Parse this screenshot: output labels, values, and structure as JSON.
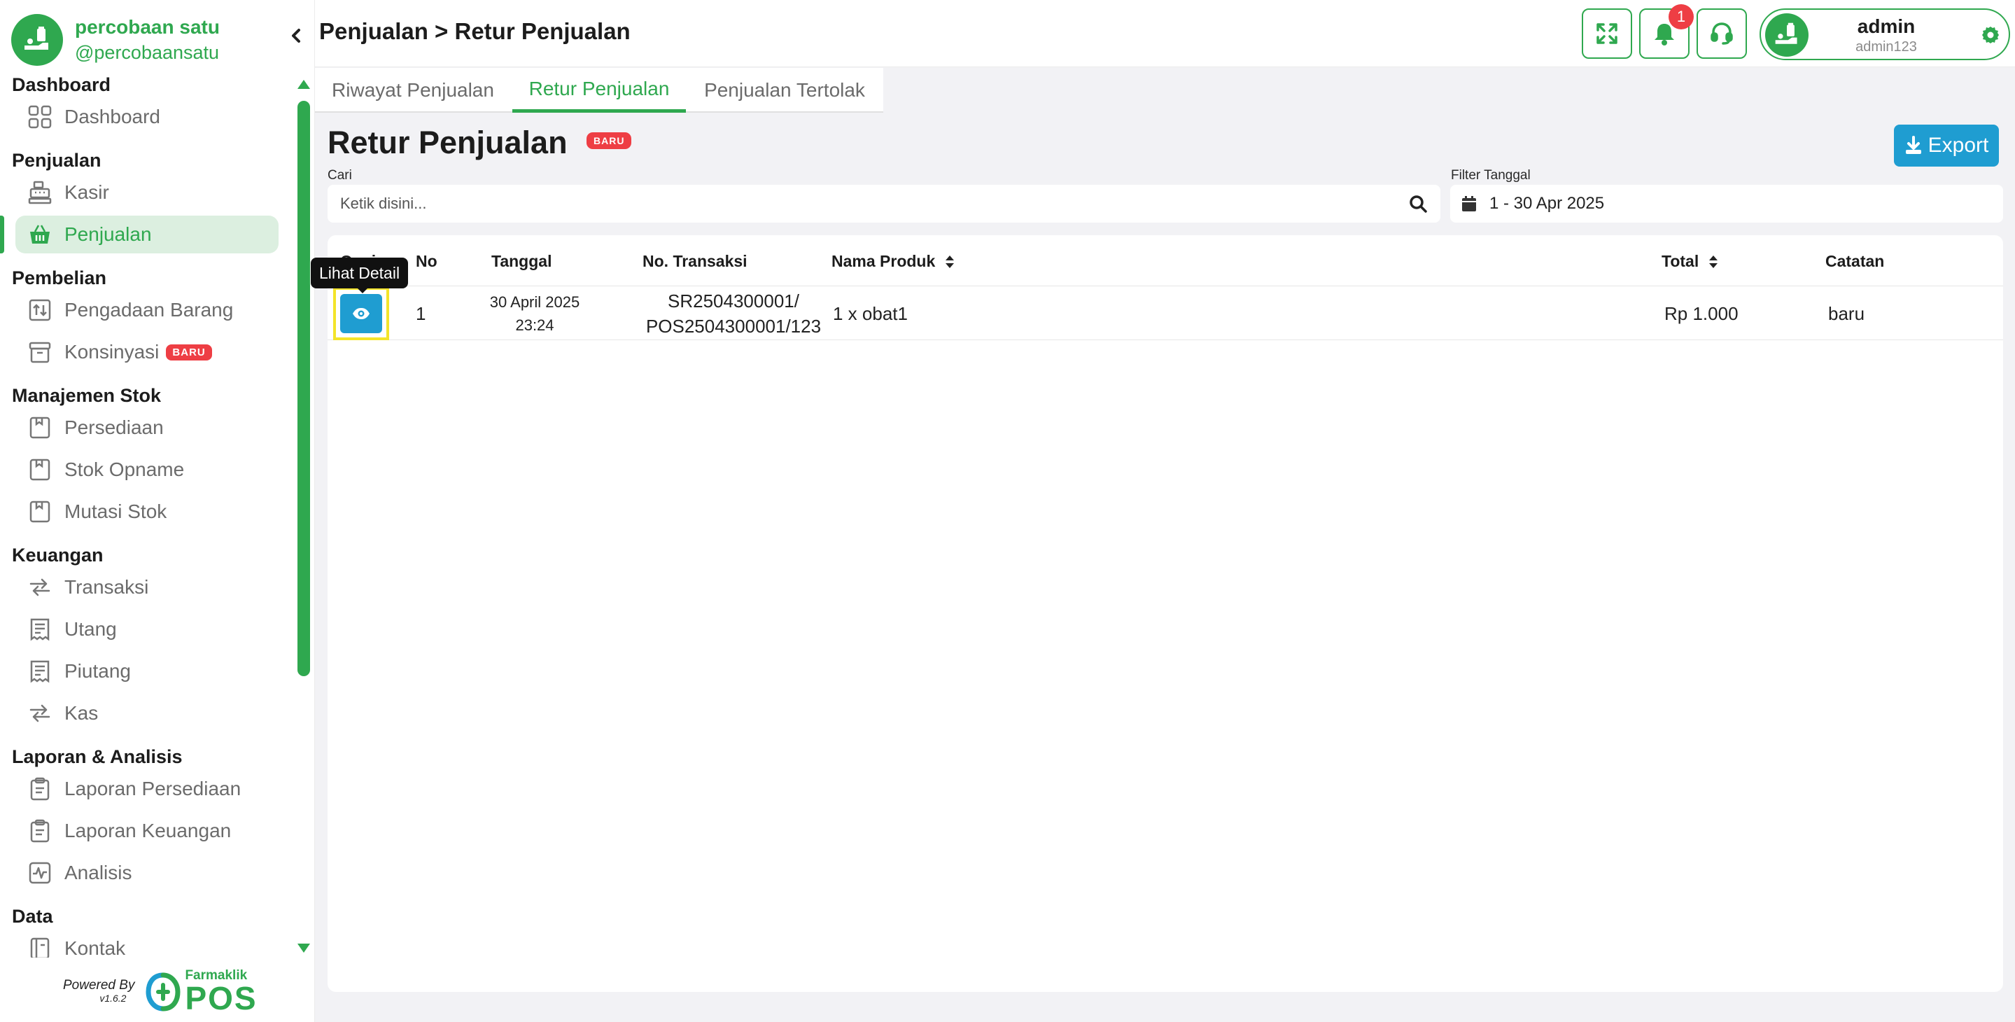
{
  "brand": {
    "name": "percobaan satu",
    "handle": "@percobaansatu"
  },
  "colors": {
    "primary": "#2fa84f",
    "accent": "#1f9dd1",
    "badge": "#ee3e44",
    "highlight": "#f3e42a"
  },
  "sidebar": {
    "sections": [
      {
        "title": "Dashboard",
        "items": [
          {
            "label": "Dashboard",
            "icon": "dashboard-grid-icon"
          }
        ]
      },
      {
        "title": "Penjualan",
        "items": [
          {
            "label": "Kasir",
            "icon": "cash-register-icon"
          },
          {
            "label": "Penjualan",
            "icon": "basket-icon",
            "active": true
          }
        ]
      },
      {
        "title": "Pembelian",
        "items": [
          {
            "label": "Pengadaan Barang",
            "icon": "procurement-icon"
          },
          {
            "label": "Konsinyasi",
            "icon": "archive-box-icon",
            "badge": "BARU"
          }
        ]
      },
      {
        "title": "Manajemen Stok",
        "items": [
          {
            "label": "Persediaan",
            "icon": "inventory-icon"
          },
          {
            "label": "Stok Opname",
            "icon": "stock-opname-icon"
          },
          {
            "label": "Mutasi Stok",
            "icon": "stock-mutation-icon"
          }
        ]
      },
      {
        "title": "Keuangan",
        "items": [
          {
            "label": "Transaksi",
            "icon": "exchange-arrows-icon"
          },
          {
            "label": "Utang",
            "icon": "receipt-icon"
          },
          {
            "label": "Piutang",
            "icon": "receipt-icon"
          },
          {
            "label": "Kas",
            "icon": "exchange-arrows-icon"
          }
        ]
      },
      {
        "title": "Laporan & Analisis",
        "items": [
          {
            "label": "Laporan Persediaan",
            "icon": "clipboard-icon"
          },
          {
            "label": "Laporan Keuangan",
            "icon": "clipboard-icon"
          },
          {
            "label": "Analisis",
            "icon": "activity-chart-icon"
          }
        ]
      },
      {
        "title": "Data",
        "items": [
          {
            "label": "Kontak",
            "icon": "contact-book-icon"
          }
        ]
      }
    ],
    "powered_by": "Powered By",
    "version": "v1.6.2",
    "farmaklik_label": "Farmaklik",
    "pos_label": "POS"
  },
  "header": {
    "breadcrumb": "Penjualan > Retur Penjualan",
    "notification_count": "1",
    "user": {
      "name": "admin",
      "username": "admin123"
    }
  },
  "tabs": [
    {
      "label": "Riwayat Penjualan",
      "active": false
    },
    {
      "label": "Retur Penjualan",
      "active": true
    },
    {
      "label": "Penjualan Tertolak",
      "active": false
    }
  ],
  "page": {
    "title": "Retur Penjualan",
    "title_badge": "BARU",
    "export_label": "Export",
    "search_label": "Cari",
    "search_placeholder": "Ketik disini...",
    "filter_label": "Filter Tanggal",
    "filter_value": "1 - 30 Apr 2025"
  },
  "table": {
    "columns": [
      {
        "label": "Opsi",
        "sortable": false
      },
      {
        "label": "No",
        "sortable": false
      },
      {
        "label": "Tanggal",
        "sortable": false
      },
      {
        "label": "No. Transaksi",
        "sortable": false
      },
      {
        "label": "Nama Produk",
        "sortable": true
      },
      {
        "label": "Total",
        "sortable": true
      },
      {
        "label": "Catatan",
        "sortable": false
      }
    ],
    "rows": [
      {
        "no": "1",
        "date": "30 April 2025",
        "time": "23:24",
        "trx_line1": "SR2504300001/",
        "trx_line2": "POS2504300001/123",
        "product": "1 x obat1",
        "total": "Rp 1.000",
        "note": "baru"
      }
    ]
  },
  "tooltip": "Lihat Detail"
}
